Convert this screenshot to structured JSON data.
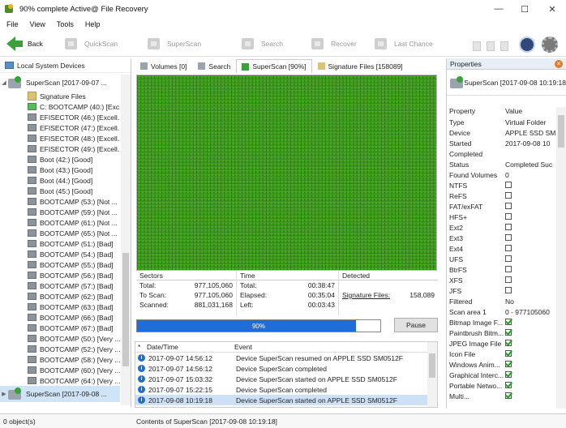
{
  "window": {
    "title": "90% complete Active@ File Recovery",
    "minimize": "—",
    "maximize": "☐",
    "close": "✕"
  },
  "menu": [
    "File",
    "View",
    "Tools",
    "Help"
  ],
  "toolbar": {
    "back": "Back",
    "quickscan": "QuickScan",
    "superscan": "SuperScan",
    "search": "Search",
    "recover": "Recover",
    "last_chance": "Last Chance"
  },
  "left_panel": {
    "header": "Local System Devices",
    "root": "SuperScan [2017-09-07 ...",
    "items": [
      {
        "label": "Signature Files",
        "kind": "sig"
      },
      {
        "label": "C: BOOTCAMP (40:) [Exc...",
        "kind": "green"
      },
      {
        "label": "EFISECTOR (46:) [Excell...",
        "kind": "part"
      },
      {
        "label": "EFISECTOR (47:) [Excell...",
        "kind": "part"
      },
      {
        "label": "EFISECTOR (48:) [Excell...",
        "kind": "part"
      },
      {
        "label": "EFISECTOR (49:) [Excell...",
        "kind": "part"
      },
      {
        "label": "Boot (42:) [Good]",
        "kind": "part"
      },
      {
        "label": "Boot (43:) [Good]",
        "kind": "part"
      },
      {
        "label": "Boot (44:) [Good]",
        "kind": "part"
      },
      {
        "label": "Boot (45:) [Good]",
        "kind": "part"
      },
      {
        "label": "BOOTCAMP (53:) [Not ...",
        "kind": "part"
      },
      {
        "label": "BOOTCAMP (59:) [Not ...",
        "kind": "part"
      },
      {
        "label": "BOOTCAMP (61:) [Not ...",
        "kind": "part"
      },
      {
        "label": "BOOTCAMP (65:) [Not ...",
        "kind": "part"
      },
      {
        "label": "BOOTCAMP (51:) [Bad]",
        "kind": "part"
      },
      {
        "label": "BOOTCAMP (54:) [Bad]",
        "kind": "part"
      },
      {
        "label": "BOOTCAMP (55:) [Bad]",
        "kind": "part"
      },
      {
        "label": "BOOTCAMP (56:) [Bad]",
        "kind": "part"
      },
      {
        "label": "BOOTCAMP (57:) [Bad]",
        "kind": "part"
      },
      {
        "label": "BOOTCAMP (62:) [Bad]",
        "kind": "part"
      },
      {
        "label": "BOOTCAMP (63:) [Bad]",
        "kind": "part"
      },
      {
        "label": "BOOTCAMP (66:) [Bad]",
        "kind": "part"
      },
      {
        "label": "BOOTCAMP (67:) [Bad]",
        "kind": "part"
      },
      {
        "label": "BOOTCAMP (50:) [Very ...",
        "kind": "part"
      },
      {
        "label": "BOOTCAMP (52:) [Very ...",
        "kind": "part"
      },
      {
        "label": "BOOTCAMP (58:) [Very ...",
        "kind": "part"
      },
      {
        "label": "BOOTCAMP (60:) [Very ...",
        "kind": "part"
      },
      {
        "label": "BOOTCAMP (64:) [Very ...",
        "kind": "part"
      }
    ],
    "root2": "SuperScan [2017-09-08 ..."
  },
  "tabs": [
    {
      "label": "Volumes [0]"
    },
    {
      "label": "Search"
    },
    {
      "label": "SuperScan [90%]"
    },
    {
      "label": "Signature Files [158089]"
    }
  ],
  "stats": {
    "sectors_head": "Sectors",
    "time_head": "Time",
    "detected_head": "Detected",
    "total_label": "Total:",
    "total_value": "977,105,060",
    "toscan_label": "To Scan:",
    "toscan_value": "977,105,060",
    "scanned_label": "Scanned:",
    "scanned_value": "881,031,168",
    "ttotal_label": "Total:",
    "ttotal_value": "00:38:47",
    "elapsed_label": "Elapsed:",
    "elapsed_value": "00:35:04",
    "left_label": "Left:",
    "left_value": "00:03:43",
    "sig_label": "Signature Files:",
    "sig_value": "158,089"
  },
  "progress": {
    "value": 90,
    "label": "90%",
    "pause": "Pause"
  },
  "events": {
    "head_sort": "*",
    "head_date": "Date/Time",
    "head_event": "Event",
    "rows": [
      {
        "date": "2017-09-07 14:56:12",
        "event": "Device SuperScan resumed on APPLE SSD SM0512F"
      },
      {
        "date": "2017-09-07 14:56:12",
        "event": "Device SuperScan completed"
      },
      {
        "date": "2017-09-07 15:03:32",
        "event": "Device SuperScan started on APPLE SSD SM0512F"
      },
      {
        "date": "2017-09-07 15:22:15",
        "event": "Device SuperScan completed"
      },
      {
        "date": "2017-09-08 10:19:18",
        "event": "Device SuperScan started on APPLE SSD SM0512F"
      }
    ]
  },
  "properties": {
    "title": "Properties",
    "header": "SuperScan [2017-09-08 10:19:18",
    "col_property": "Property",
    "col_value": "Value",
    "rows": [
      {
        "name": "Type",
        "value": "Virtual Folder"
      },
      {
        "name": "Device",
        "value": "APPLE SSD SM"
      },
      {
        "name": "Started",
        "value": "2017-09-08 10"
      },
      {
        "name": "Completed",
        "value": ""
      },
      {
        "name": "Status",
        "value": "Completed Suc"
      },
      {
        "name": "Found Volumes",
        "value": "0"
      },
      {
        "name": "NTFS",
        "check": "off"
      },
      {
        "name": "ReFS",
        "check": "off"
      },
      {
        "name": "FAT/exFAT",
        "check": "off"
      },
      {
        "name": "HFS+",
        "check": "off"
      },
      {
        "name": "Ext2",
        "check": "off"
      },
      {
        "name": "Ext3",
        "check": "off"
      },
      {
        "name": "Ext4",
        "check": "off"
      },
      {
        "name": "UFS",
        "check": "off"
      },
      {
        "name": "BtrFS",
        "check": "off"
      },
      {
        "name": "XFS",
        "check": "off"
      },
      {
        "name": "JFS",
        "check": "off"
      },
      {
        "name": "Filtered",
        "value": "No"
      },
      {
        "name": "Scan area 1",
        "value": "0 - 977105060"
      },
      {
        "name": "Bitmap Image F...",
        "check": "on"
      },
      {
        "name": "Paintbrush Bitm...",
        "check": "on"
      },
      {
        "name": "JPEG Image File",
        "check": "on"
      },
      {
        "name": "Icon File",
        "check": "on"
      },
      {
        "name": "Windows Anim...",
        "check": "on"
      },
      {
        "name": "Graphical Interc...",
        "check": "on"
      },
      {
        "name": "Portable Netwo...",
        "check": "on"
      },
      {
        "name": "Multi...",
        "check": "on"
      }
    ]
  },
  "statusbar": {
    "left": "0 object(s)",
    "right": "Contents of SuperScan [2017-09-08 10:19:18]"
  }
}
